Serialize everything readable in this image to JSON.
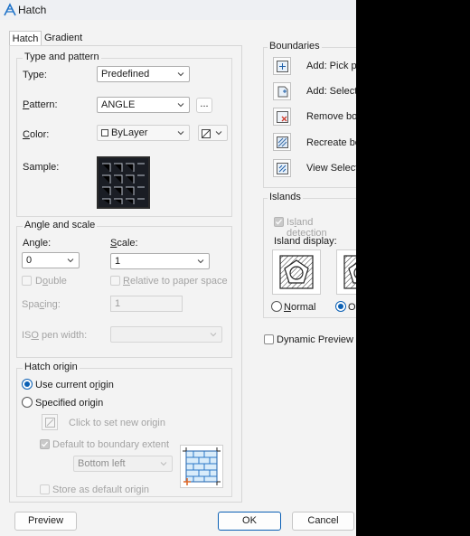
{
  "window": {
    "title": "Hatch"
  },
  "tabs": [
    "Hatch",
    "Gradient"
  ],
  "type_pattern": {
    "group_title": "Type and pattern",
    "type_label": "Type:",
    "type_value": "Predefined",
    "pattern_label": "Pattern:",
    "pattern_value": "ANGLE",
    "browse_label": "...",
    "color_label": "Color:",
    "color_value": "ByLayer",
    "sample_label": "Sample:"
  },
  "angle_scale": {
    "group_title": "Angle and scale",
    "angle_label": "Angle:",
    "angle_value": "0",
    "scale_label": "Scale:",
    "scale_value": "1",
    "double_label": "Double",
    "relative_label": "Relative to paper space",
    "spacing_label": "Spacing:",
    "spacing_value": "1",
    "iso_label": "ISO pen width:"
  },
  "origin": {
    "group_title": "Hatch origin",
    "use_current": "Use current origin",
    "specified": "Specified origin",
    "click_set": "Click to set new origin",
    "default_extent": "Default to boundary extent",
    "position_value": "Bottom left",
    "store_default": "Store as default origin"
  },
  "boundaries": {
    "group_title": "Boundaries",
    "items": [
      "Add: Pick po",
      "Add: Select o",
      "Remove bou",
      "Recreate bou",
      "View Selectio"
    ]
  },
  "islands": {
    "group_title": "Islands",
    "detection_label": "Island detection",
    "display_label": "Island display:",
    "normal_label": "Normal",
    "outer_label": "Ou"
  },
  "dynamic_preview_label": "Dynamic Preview",
  "buttons": {
    "preview": "Preview",
    "ok": "OK",
    "cancel": "Cancel"
  },
  "colors": {
    "accent": "#0a5fb4",
    "sample_bg": "#1a1d24",
    "remove_red": "#d03a2b",
    "origin_red": "#e06a2a"
  }
}
